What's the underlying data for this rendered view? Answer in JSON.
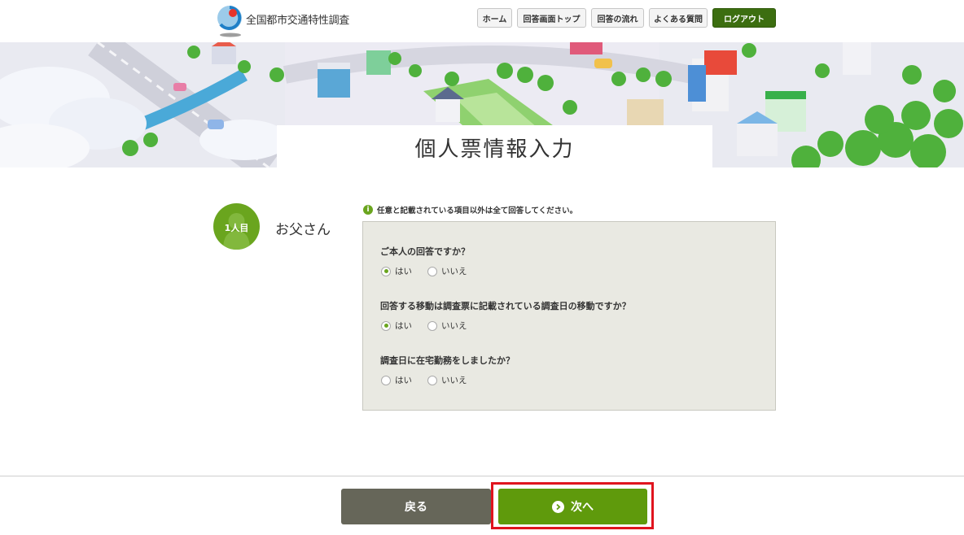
{
  "header": {
    "site_name": "全国都市交通特性調査",
    "nav": {
      "home": "ホーム",
      "answer_top": "回答画面トップ",
      "flow": "回答の流れ",
      "faq": "よくある質問",
      "logout": "ログアウト"
    }
  },
  "page": {
    "title": "個人票情報入力"
  },
  "person": {
    "number": "1人目",
    "name": "お父さん"
  },
  "notice": {
    "text": "任意と記載されている項目以外は全て回答してください。"
  },
  "questions": [
    {
      "label": "ご本人の回答ですか？",
      "options": [
        "はい",
        "いいえ"
      ],
      "selected": "はい"
    },
    {
      "label": "回答する移動は調査票に記載されている調査日の移動ですか？",
      "options": [
        "はい",
        "いいえ"
      ],
      "selected": "はい"
    },
    {
      "label": "調査日に在宅勤務をしましたか？",
      "options": [
        "はい",
        "いいえ"
      ],
      "selected": ""
    }
  ],
  "footer": {
    "back_label": "戻る",
    "next_label": "次へ"
  },
  "colors": {
    "accent_green": "#5f9a0c",
    "logout_green": "#3c6e10",
    "back_gray": "#666659",
    "highlight_red": "#e0141e",
    "panel_bg": "#e9e9e2"
  }
}
